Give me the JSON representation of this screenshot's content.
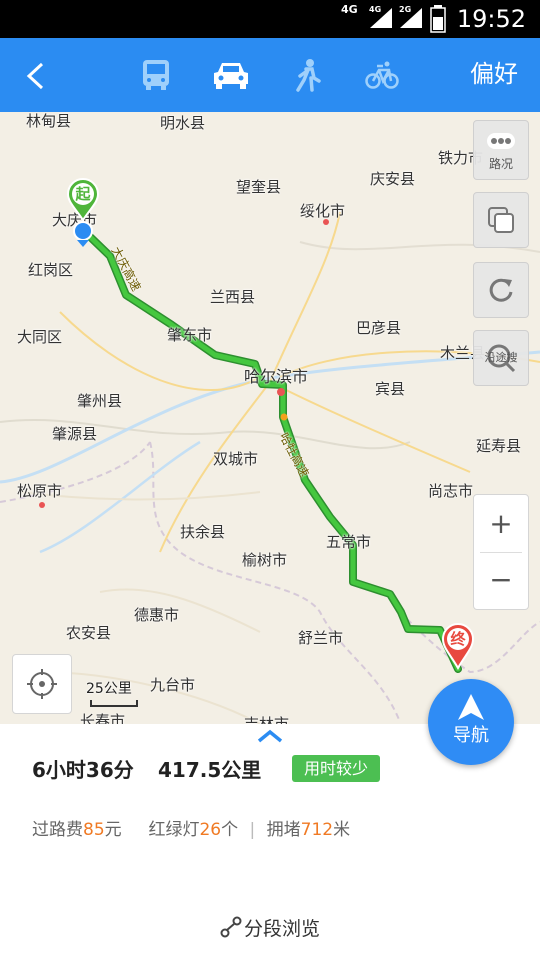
{
  "status_bar": {
    "net1": "4G",
    "net2": "4G",
    "net3": "2G",
    "time": "19:52"
  },
  "topbar": {
    "modes": [
      {
        "icon": "bus-icon",
        "label": "公交"
      },
      {
        "icon": "car-icon",
        "label": "驾车",
        "selected": true
      },
      {
        "icon": "walk-icon",
        "label": "步行"
      },
      {
        "icon": "bike-icon",
        "label": "骑行"
      }
    ],
    "preference_label": "偏好"
  },
  "map": {
    "place_labels": [
      "林甸县",
      "明水县",
      "铁力市",
      "庆安县",
      "望奎县",
      "绥化市",
      "大庆市",
      "红岗区",
      "兰西县",
      "巴彦县",
      "大同区",
      "肇东市",
      "木兰县",
      "哈尔滨市",
      "宾县",
      "肇州县",
      "肇源县",
      "双城市",
      "延寿县",
      "松原市",
      "尚志市",
      "扶余县",
      "五常市",
      "榆树市",
      "德惠市",
      "舒兰市",
      "农安县",
      "九台市",
      "长春市",
      "吉林市"
    ],
    "road_labels": [
      "大庆高速",
      "哈牡高速"
    ],
    "start_marker": "起",
    "end_marker": "终",
    "traffic_button": "路况",
    "along_search_button": "沿途搜",
    "zoom_in": "+",
    "zoom_out": "−",
    "scale": "25公里"
  },
  "summary": {
    "duration": "6小时36分",
    "distance": "417.5公里",
    "tag": "用时较少",
    "toll_label": "过路费",
    "toll_value": "85",
    "toll_unit": "元",
    "lights_label": "红绿灯",
    "lights_value": "26",
    "lights_unit": "个",
    "jam_label": "拥堵",
    "jam_value": "712",
    "jam_unit": "米",
    "segment_browse": "分段浏览"
  },
  "navigate_button": "导航",
  "colors": {
    "accent": "#2b8cf2",
    "route": "#3ab53a",
    "highlight": "#f07a24",
    "tag": "#4cbf52"
  }
}
